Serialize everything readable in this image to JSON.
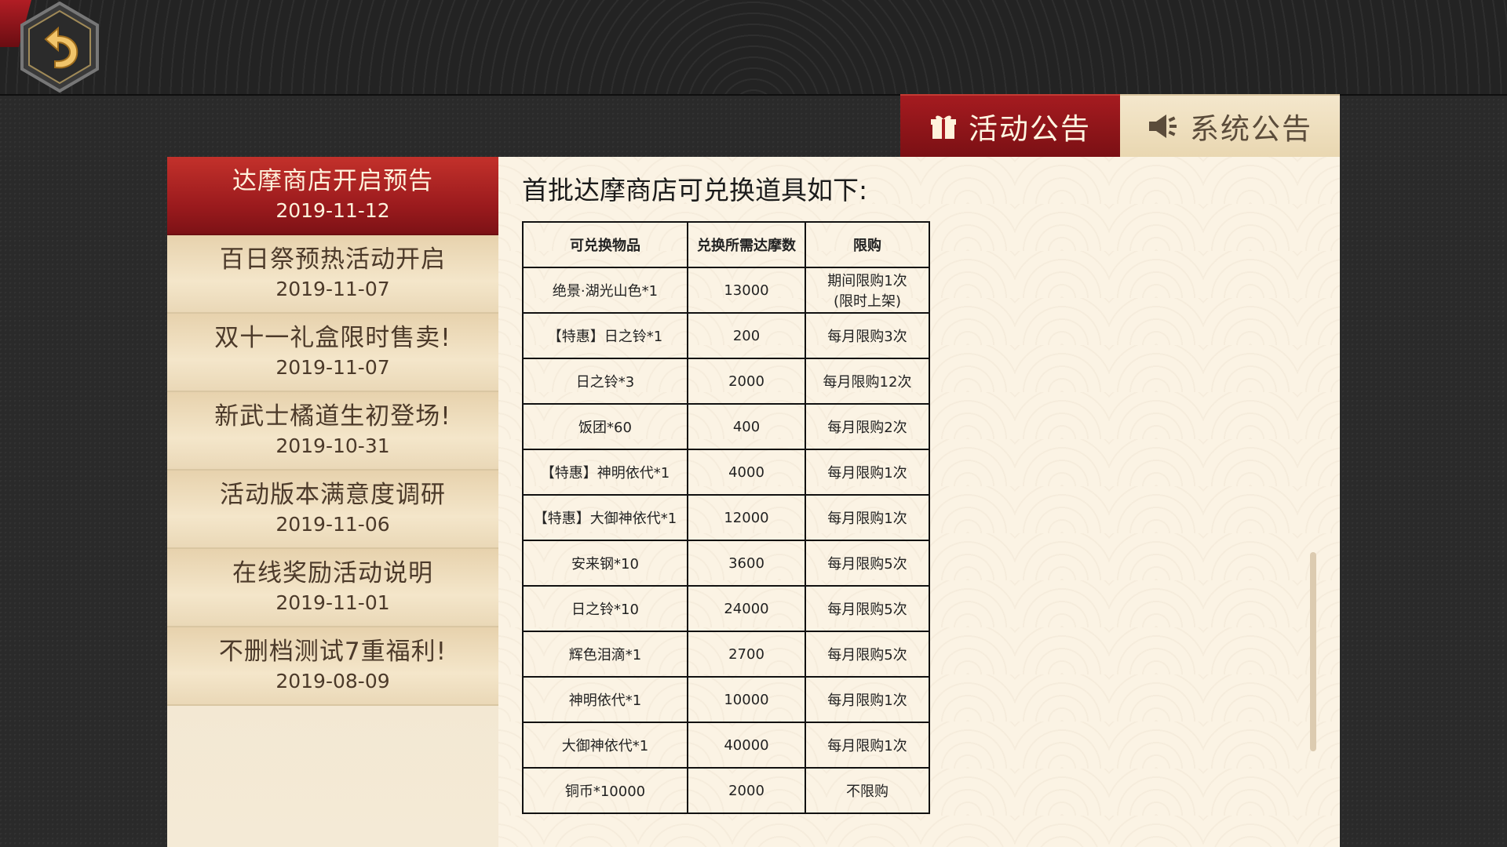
{
  "tabs": [
    {
      "label": "活动公告",
      "icon": "gift-icon",
      "active": true
    },
    {
      "label": "系统公告",
      "icon": "speaker-icon",
      "active": false
    }
  ],
  "sidebar": {
    "items": [
      {
        "title": "达摩商店开启预告",
        "date": "2019-11-12",
        "active": true
      },
      {
        "title": "百日祭预热活动开启",
        "date": "2019-11-07"
      },
      {
        "title": "双十一礼盒限时售卖!",
        "date": "2019-11-07"
      },
      {
        "title": "新武士橘道生初登场!",
        "date": "2019-10-31"
      },
      {
        "title": "活动版本满意度调研",
        "date": "2019-11-06"
      },
      {
        "title": "在线奖励活动说明",
        "date": "2019-11-01"
      },
      {
        "title": "不删档测试7重福利!",
        "date": "2019-08-09"
      }
    ]
  },
  "content": {
    "title": "首批达摩商店可兑换道具如下:",
    "table": {
      "headers": [
        "可兑换物品",
        "兑换所需达摩数",
        "限购"
      ],
      "rows": [
        [
          "绝景·湖光山色*1",
          "13000",
          "期间限购1次",
          "(限时上架)"
        ],
        [
          "【特惠】日之铃*1",
          "200",
          "每月限购3次"
        ],
        [
          "日之铃*3",
          "2000",
          "每月限购12次"
        ],
        [
          "饭团*60",
          "400",
          "每月限购2次"
        ],
        [
          "【特惠】神明依代*1",
          "4000",
          "每月限购1次"
        ],
        [
          "【特惠】大御神依代*1",
          "12000",
          "每月限购1次"
        ],
        [
          "安来钢*10",
          "3600",
          "每月限购5次"
        ],
        [
          "日之铃*10",
          "24000",
          "每月限购5次"
        ],
        [
          "辉色泪滴*1",
          "2700",
          "每月限购5次"
        ],
        [
          "神明依代*1",
          "10000",
          "每月限购1次"
        ],
        [
          "大御神依代*1",
          "40000",
          "每月限购1次"
        ],
        [
          "铜币*10000",
          "2000",
          "不限购"
        ]
      ]
    }
  },
  "colors": {
    "accent_red": "#9a1a1d",
    "panel_bg": "#fbf3e4",
    "sidebar_bg": "#efe2c7"
  }
}
